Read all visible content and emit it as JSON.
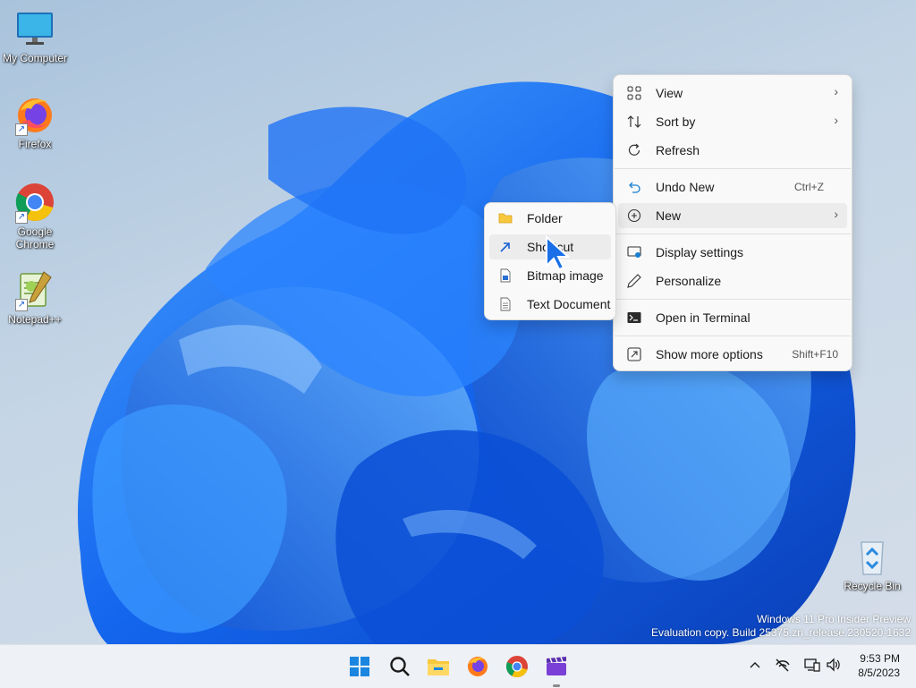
{
  "desktop": {
    "icons": [
      {
        "label": "My Computer",
        "icon": "monitor-icon"
      },
      {
        "label": "Firefox",
        "icon": "firefox-icon"
      },
      {
        "label": "Google Chrome",
        "icon": "chrome-icon"
      },
      {
        "label": "Notepad++",
        "icon": "notepadpp-icon"
      },
      {
        "label": "Recycle Bin",
        "icon": "recycle-bin-icon"
      }
    ],
    "watermark": {
      "line1": "Windows 11 Pro Insider Preview",
      "line2": "Evaluation copy. Build 25375.zn_release.230520-1632"
    }
  },
  "context_menu": {
    "items": [
      {
        "label": "View",
        "icon": "grid-view-icon",
        "submenu": true
      },
      {
        "label": "Sort by",
        "icon": "sort-icon",
        "submenu": true
      },
      {
        "label": "Refresh",
        "icon": "refresh-icon"
      },
      {
        "label": "Undo New",
        "icon": "undo-icon",
        "shortcut": "Ctrl+Z"
      },
      {
        "label": "New",
        "icon": "new-plus-icon",
        "submenu": true,
        "highlighted": true
      },
      {
        "label": "Display settings",
        "icon": "display-icon"
      },
      {
        "label": "Personalize",
        "icon": "pen-icon"
      },
      {
        "label": "Open in Terminal",
        "icon": "terminal-icon"
      },
      {
        "label": "Show more options",
        "icon": "more-options-icon",
        "shortcut": "Shift+F10"
      }
    ],
    "chevron": "›"
  },
  "new_submenu": {
    "items": [
      {
        "label": "Folder",
        "icon": "folder-icon"
      },
      {
        "label": "Shortcut",
        "icon": "shortcut-icon"
      },
      {
        "label": "Bitmap image",
        "icon": "bitmap-icon"
      },
      {
        "label": "Text Document",
        "icon": "text-document-icon"
      }
    ]
  },
  "taskbar": {
    "apps": [
      "start-icon",
      "search-icon",
      "file-explorer-icon",
      "firefox-icon",
      "chrome-icon",
      "clapper-icon"
    ],
    "clock": {
      "time": "9:53 PM",
      "date": "8/5/2023"
    }
  },
  "colors": {
    "accent": "#0067c0",
    "bloom": "#1a6cf0"
  }
}
